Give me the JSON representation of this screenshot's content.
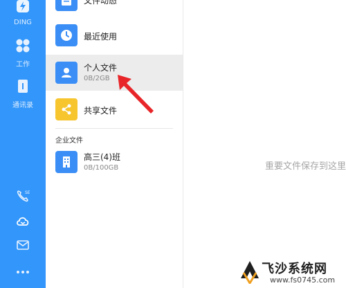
{
  "colors": {
    "rail": "#3296fa",
    "blue": "#3a8ef6",
    "yellow": "#f7c52e",
    "arrow": "#e8262a"
  },
  "rail": {
    "items": [
      {
        "label": "DING",
        "icon": "lightning-icon"
      },
      {
        "label": "工作",
        "icon": "apps-grid-icon"
      },
      {
        "label": "通讯录",
        "icon": "contacts-book-icon"
      }
    ],
    "bottom_icons": [
      "phone-icon",
      "cloud-drive-icon",
      "mail-icon",
      "more-dots-icon"
    ]
  },
  "panel": {
    "items": [
      {
        "name": "文件动态",
        "sub": "",
        "icon": "document-icon",
        "color": "#3a8ef6"
      },
      {
        "name": "最近使用",
        "sub": "",
        "icon": "clock-icon",
        "color": "#3a8ef6"
      },
      {
        "name": "个人文件",
        "sub": "0B/2GB",
        "icon": "person-icon",
        "color": "#3a8ef6"
      },
      {
        "name": "共享文件",
        "sub": "",
        "icon": "share-icon",
        "color": "#f7c52e"
      }
    ],
    "section_label": "企业文件",
    "enterprise": [
      {
        "name": "高三(4)班",
        "sub": "0B/100GB",
        "icon": "building-icon",
        "color": "#3a8ef6"
      }
    ]
  },
  "main": {
    "empty_text": "重要文件保存到这里"
  },
  "watermark": {
    "title": "飞沙系统网",
    "url": "www.fs0745.com"
  }
}
